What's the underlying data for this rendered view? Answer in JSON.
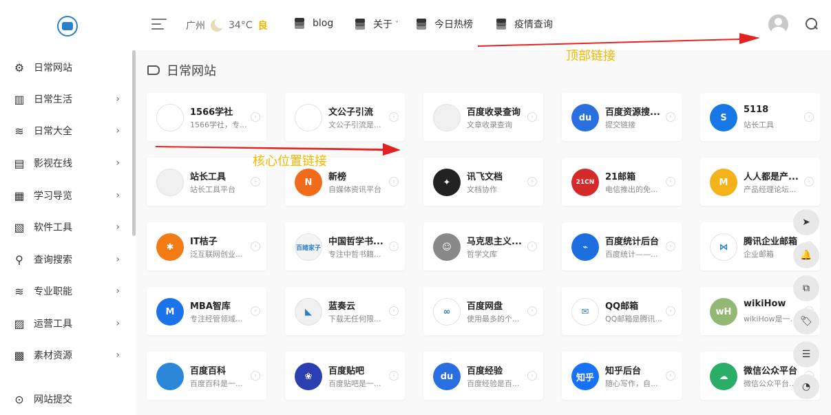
{
  "header": {
    "city": "广州",
    "temperature": "34°C",
    "air_quality": "良",
    "nav": [
      {
        "label": "blog",
        "has_caret": false
      },
      {
        "label": "关于",
        "has_caret": true
      },
      {
        "label": "今日热榜",
        "has_caret": false
      },
      {
        "label": "疫情查询",
        "has_caret": false
      }
    ]
  },
  "sidebar": {
    "items": [
      {
        "label": "日常网站",
        "icon": "gear-icon",
        "has_arrow": false
      },
      {
        "label": "日常生活",
        "icon": "building-icon",
        "has_arrow": true
      },
      {
        "label": "日常大全",
        "icon": "layers-icon",
        "has_arrow": true
      },
      {
        "label": "影视在线",
        "icon": "film-icon",
        "has_arrow": true
      },
      {
        "label": "学习导览",
        "icon": "book-icon",
        "has_arrow": true
      },
      {
        "label": "软件工具",
        "icon": "document-icon",
        "has_arrow": true
      },
      {
        "label": "查询搜索",
        "icon": "magnifier-icon",
        "has_arrow": true
      },
      {
        "label": "专业职能",
        "icon": "layers-icon",
        "has_arrow": true
      },
      {
        "label": "运营工具",
        "icon": "chart-icon",
        "has_arrow": true
      },
      {
        "label": "素材资源",
        "icon": "archive-icon",
        "has_arrow": true
      },
      {
        "label": "网站提交",
        "icon": "submit-icon",
        "has_arrow": false
      }
    ]
  },
  "main": {
    "section_title": "日常网站",
    "cards": [
      {
        "name": "1566学社",
        "desc": "1566学社，专...",
        "icon_text": "",
        "color": "#ffffff",
        "icon": "ship-logo-icon"
      },
      {
        "name": "文公子引流",
        "desc": "文公子引流是...",
        "icon_text": "",
        "color": "#ffffff",
        "icon": "ship-logo-icon"
      },
      {
        "name": "百度收录查询",
        "desc": "文章收录查询",
        "icon_text": "",
        "color": "#f0f0f0",
        "icon": "square-logo-icon"
      },
      {
        "name": "百度资源搜...",
        "desc": "提交链接",
        "icon_text": "du",
        "color": "#2a6fe0",
        "icon": "baidu-paw-icon"
      },
      {
        "name": "5118",
        "desc": "站长工具",
        "icon_text": "S",
        "color": "#1877e6",
        "icon": "5118-logo-icon"
      },
      {
        "name": "站长工具",
        "desc": "站长工具平台",
        "icon_text": "",
        "color": "#f0f0f0",
        "icon": "square-logo-icon"
      },
      {
        "name": "新榜",
        "desc": "自媒体资讯平台",
        "icon_text": "N",
        "color": "#f26b1d",
        "icon": "xinbang-logo-icon"
      },
      {
        "name": "讯飞文档",
        "desc": "文档协作",
        "icon_text": "✦",
        "color": "#222222",
        "icon": "bird-logo-icon"
      },
      {
        "name": "21邮箱",
        "desc": "电信推出的免...",
        "icon_text": "21CN",
        "color": "#d42a2a",
        "icon": "21cn-logo-icon"
      },
      {
        "name": "人人都是产...",
        "desc": "产品经理论坛...",
        "icon_text": "M",
        "color": "#f3b21a",
        "icon": "woshipm-logo-icon"
      },
      {
        "name": "IT桔子",
        "desc": "泛互联网创业...",
        "icon_text": "✱",
        "color": "#f27b16",
        "icon": "orange-logo-icon"
      },
      {
        "name": "中国哲学书...",
        "desc": "专注中哲书籍...",
        "icon_text": "百諸家子",
        "color": "#f4f4f4",
        "icon": "ctext-logo-icon"
      },
      {
        "name": "马克思主义...",
        "desc": "哲学文库",
        "icon_text": "☺",
        "color": "#888888",
        "icon": "portrait-logo-icon"
      },
      {
        "name": "百度统计后台",
        "desc": "百度统计——...",
        "icon_text": "⌁",
        "color": "#1d6fe0",
        "icon": "stats-logo-icon"
      },
      {
        "name": "腾讯企业邮箱",
        "desc": "企业邮箱",
        "icon_text": "⋈",
        "color": "#ffffff",
        "icon": "tencent-mail-logo-icon"
      },
      {
        "name": "MBA智库",
        "desc": "专注经管领域...",
        "icon_text": "M",
        "color": "#1a73e8",
        "icon": "mba-logo-icon"
      },
      {
        "name": "蓝奏云",
        "desc": "下载无任何限...",
        "icon_text": "◣",
        "color": "#f0f0f0",
        "icon": "lanzou-logo-icon"
      },
      {
        "name": "百度网盘",
        "desc": "使用最多的个...",
        "icon_text": "∞",
        "color": "#ffffff",
        "icon": "cloud-disk-logo-icon"
      },
      {
        "name": "QQ邮箱",
        "desc": "QQ邮箱是腾讯...",
        "icon_text": "✉",
        "color": "#ffffff",
        "icon": "qq-mail-logo-icon"
      },
      {
        "name": "wikiHow",
        "desc": "wikiHow是一个...",
        "icon_text": "wH",
        "color": "#93b874",
        "icon": "wikihow-logo-icon"
      },
      {
        "name": "百度百科",
        "desc": "百度百科是一...",
        "icon_text": "",
        "color": "#2c86d8",
        "icon": "baike-logo-icon"
      },
      {
        "name": "百度贴吧",
        "desc": "百度贴吧是一...",
        "icon_text": "❀",
        "color": "#2b3fb0",
        "icon": "tieba-logo-icon"
      },
      {
        "name": "百度经验",
        "desc": "百度经验是百...",
        "icon_text": "du",
        "color": "#2a6fe0",
        "icon": "baidu-paw-icon"
      },
      {
        "name": "知乎后台",
        "desc": "随心写作，自...",
        "icon_text": "知乎",
        "color": "#1772f6",
        "icon": "zhihu-logo-icon"
      },
      {
        "name": "微信公众平台",
        "desc": "微信公众平台...",
        "icon_text": "☁",
        "color": "#2aae67",
        "icon": "wechat-logo-icon"
      }
    ]
  },
  "annotations": {
    "top_label": "顶部链接",
    "core_label": "核心位置链接"
  },
  "floating_buttons": [
    "arrow-up-icon",
    "bell-icon",
    "copy-icon",
    "tag-icon",
    "list-icon",
    "history-icon"
  ]
}
